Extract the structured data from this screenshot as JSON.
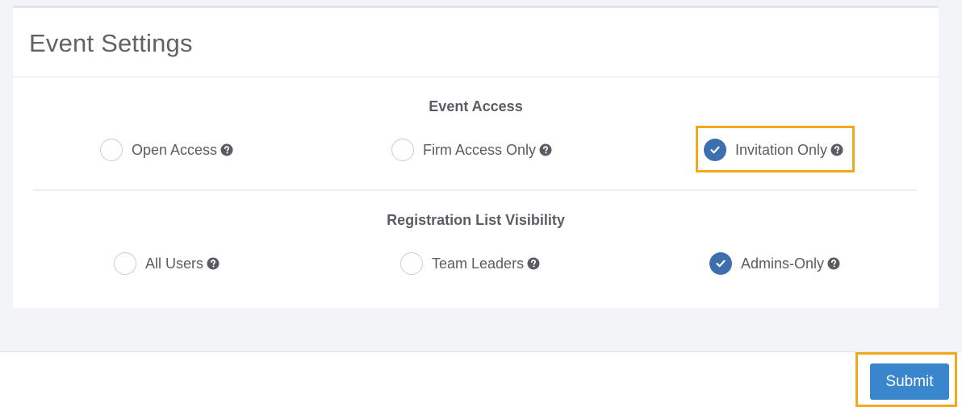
{
  "card": {
    "title": "Event Settings"
  },
  "event_access": {
    "title": "Event Access",
    "options": [
      {
        "label": "Open Access",
        "checked": false
      },
      {
        "label": "Firm Access Only",
        "checked": false
      },
      {
        "label": "Invitation Only",
        "checked": true
      }
    ]
  },
  "registration_visibility": {
    "title": "Registration List Visibility",
    "options": [
      {
        "label": "All Users",
        "checked": false
      },
      {
        "label": "Team Leaders",
        "checked": false
      },
      {
        "label": "Admins-Only",
        "checked": true
      }
    ]
  },
  "footer": {
    "submit_label": "Submit"
  },
  "colors": {
    "accent": "#3d6fae",
    "button": "#3a86cc",
    "highlight": "#f0a81c"
  },
  "icons": {
    "help": "question-circle-icon",
    "check": "check-icon"
  }
}
